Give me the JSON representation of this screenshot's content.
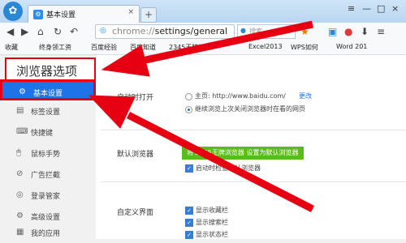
{
  "titlebar": {
    "logo_glyph": "✿",
    "tab_label": "基本设置",
    "tab_close": "×",
    "new_tab": "+",
    "controls": [
      "≡",
      "—",
      "□",
      "×"
    ]
  },
  "toolbar": {
    "address_prefix": "chrome://",
    "address_path": "settings/general",
    "search_placeholder": "搜索"
  },
  "bookmarks": [
    "收藏",
    "终身领工资",
    "百度经验",
    "百度知道",
    "2345王牌浏览器",
    "Excel2013",
    "WPS如何",
    "Word 201"
  ],
  "sidebar": {
    "title": "浏览器选项",
    "items": [
      {
        "icon": "⚙",
        "label": "基本设置"
      },
      {
        "icon": "▤",
        "label": "标签设置"
      },
      {
        "icon": "⌨",
        "label": "快捷键"
      },
      {
        "icon": "🖱",
        "label": "鼠标手势"
      },
      {
        "icon": "⊘",
        "label": "广告拦截"
      },
      {
        "icon": "◎",
        "label": "登录管家"
      },
      {
        "icon": "⚙",
        "label": "高级设置"
      },
      {
        "icon": "▦",
        "label": "我的应用"
      }
    ]
  },
  "main": {
    "startup": {
      "label": "启动时打开",
      "option1": "主页: http://www.baidu.com/",
      "change": "更改",
      "option2": "继续浏览上次关闭浏览器时在看的网页"
    },
    "default_browser": {
      "label": "默认浏览器",
      "button": "将 2345王牌浏览器 设置为默认浏览器",
      "check": "启动时检查默认浏览器"
    },
    "custom_ui": {
      "label": "自定义界面",
      "checks": [
        "显示收藏栏",
        "显示搜索栏",
        "显示状态栏"
      ]
    }
  },
  "colors": {
    "accent": "#1e73e8",
    "highlight": "#e60012",
    "button": "#5bbb1b"
  }
}
